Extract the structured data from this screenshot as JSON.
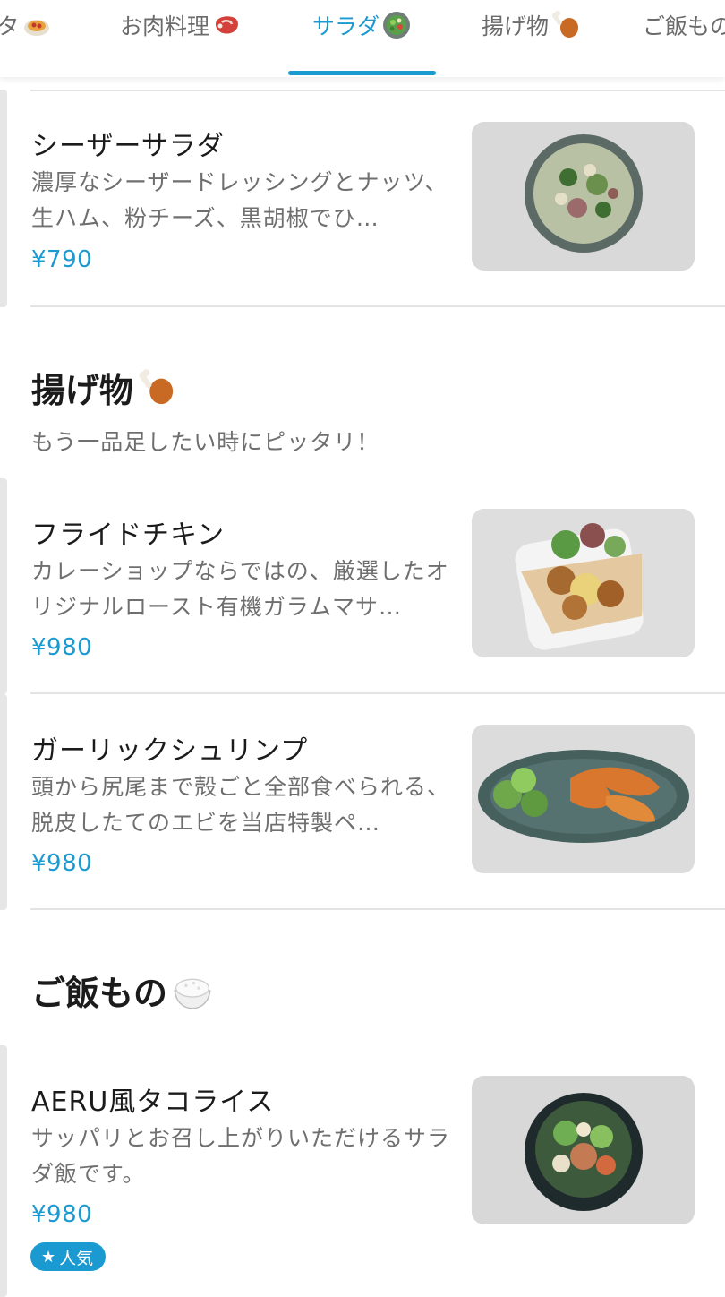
{
  "tabs": [
    {
      "label": "タ",
      "icon": "spaghetti-icon",
      "active": false
    },
    {
      "label": "お肉料理",
      "icon": "meat-icon",
      "active": false
    },
    {
      "label": "サラダ",
      "icon": "salad-icon",
      "active": true
    },
    {
      "label": "揚げ物",
      "icon": "drumstick-icon",
      "active": false
    },
    {
      "label": "ご飯もの",
      "icon": "rice-icon",
      "active": false
    }
  ],
  "sections": {
    "salad_items": [
      {
        "name": "シーザーサラダ",
        "description": "濃厚なシーザードレッシングとナッツ、生ハム、粉チーズ、黒胡椒でひ…",
        "price": "¥790",
        "image": "caesar-salad-photo"
      }
    ],
    "fried": {
      "title": "揚げ物",
      "title_icon": "drumstick-icon",
      "subtitle": "もう一品足したい時にピッタリ！",
      "items": [
        {
          "name": "フライドチキン",
          "description": "カレーショップならではの、厳選したオリジナルロースト有機ガラムマサ…",
          "price": "¥980",
          "image": "fried-chicken-photo"
        },
        {
          "name": "ガーリックシュリンプ",
          "description": "頭から尻尾まで殻ごと全部食べられる、脱皮したてのエビを当店特製ペ…",
          "price": "¥980",
          "image": "garlic-shrimp-photo"
        }
      ]
    },
    "rice": {
      "title": "ご飯もの",
      "title_icon": "rice-icon",
      "items": [
        {
          "name": "AERU風タコライス",
          "description": "サッパリとお召し上がりいただけるサラダ飯です。",
          "price": "¥980",
          "image": "taco-rice-photo",
          "badge": "人気",
          "badge_icon": "star-icon"
        }
      ]
    }
  },
  "colors": {
    "accent": "#1a9ad0",
    "text": "#1b1b1b",
    "muted": "#6f6f6f"
  }
}
